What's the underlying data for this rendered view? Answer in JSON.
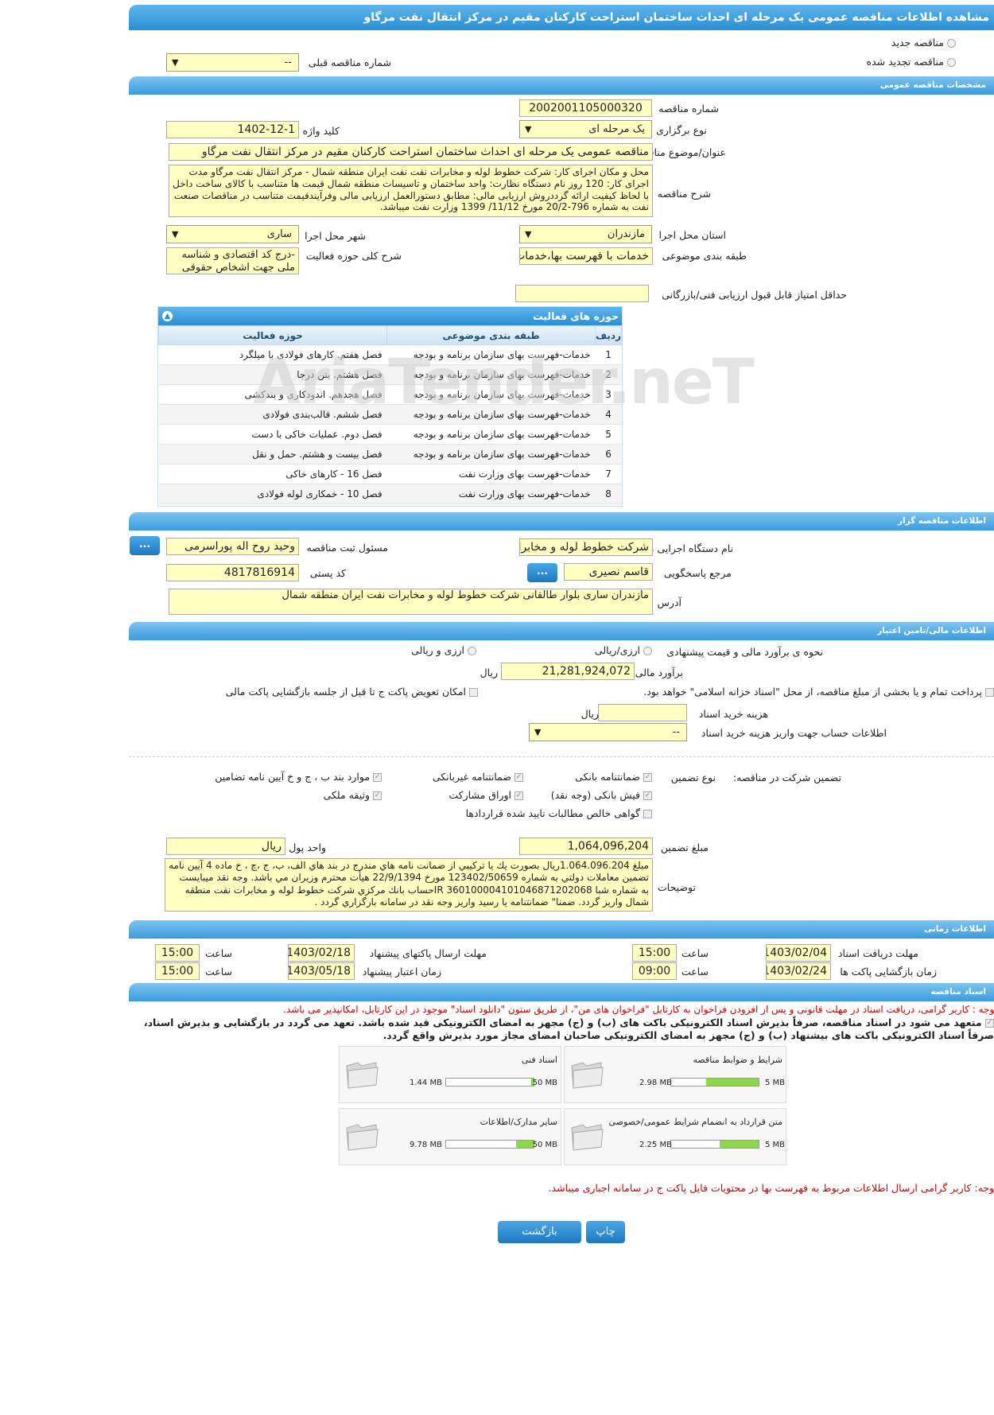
{
  "page_title": "مشاهده اطلاعات مناقصه عمومی یک مرحله ای احداث ساختمان استراحت کارکنان مقیم در مرکز انتقال نفت مرگاو",
  "top": {
    "new_tender": "مناقصه جدید",
    "renewed_tender": "مناقصه تجدید شده",
    "prev_number_label": "شماره مناقصه قبلی",
    "prev_number_value": "--"
  },
  "general": {
    "section": "مشخصات مناقصه عمومی",
    "number_label": "شماره مناقصه",
    "number_value": "2002001105000320",
    "type_label": "نوع برگزاری",
    "type_value": "یک مرحله ای",
    "keyword_label": "کلید واژه",
    "keyword_value": "1402-12-1",
    "subject_label": "عنوان/موضوع مناقصه",
    "subject_value": "مناقصه عمومی یک مرحله ای احداث ساختمان استراحت کارکنان مقیم در مرکز انتقال نفت مرگاو",
    "desc_label": "شرح مناقصه",
    "desc_value": "محل و مکان اجرای کار:  شرکت خطوط لوله و مخابرات نفت  نفت ایران منطقه شمال  - مرکز انتقال نفت مرگاو مدت اجرای کار: 120 روز نام دستگاه نظارت: واحد ساختمان و تاسیسات منطقه شمال قیمت ها متناسب با کالای ساخت داخل با لحاظ کیفیت ارائه گرددروش ارزیابی مالی: مطابق دستورالعمل ارزیابی مالی وفرآیندقیمت متناسب در مناقصات صنعت نفت به شماره 796-20/2 مورخ 11/12/ 1399 وزارت نفت میباشد.",
    "province_label": "استان محل اجرا",
    "province_value": "مازندران",
    "city_label": "شهر محل اجرا",
    "city_value": "ساری",
    "category_label": "طبقه بندی موضوعی",
    "category_value": "خدمات با فهرست بها،خدمات",
    "activity_desc_label": "شرح کلی حوزه فعالیت",
    "activity_desc_value": "-درج کد اقتصادی و شناسه ملی جهت اشخاص حقوقی در",
    "min_score_label": "حداقل امتیاز قابل قبول ارزیابی فنی/بازرگانی",
    "min_score_value": ""
  },
  "activities": {
    "title": "حوزه های فعالیت",
    "headers": [
      "ردیف",
      "طبقه بندی موضوعی",
      "حوزه فعالیت"
    ],
    "rows": [
      [
        "1",
        "خدمات-فهرست بهای سازمان برنامه و بودجه",
        "فصل هفتم. کارهای فولادی با میلگرد"
      ],
      [
        "2",
        "خدمات-فهرست بهای سازمان برنامه و بودجه",
        "فصل هشتم. بتن درجا"
      ],
      [
        "3",
        "خدمات-فهرست بهای سازمان برنامه و بودجه",
        "فصل هجدهم. اندودکاری و بندکشی"
      ],
      [
        "4",
        "خدمات-فهرست بهای سازمان برنامه و بودجه",
        "فصل ششم. قالب‌بندی فولادی"
      ],
      [
        "5",
        "خدمات-فهرست بهای سازمان برنامه و بودجه",
        "فصل دوم. عملیات خاکی با دست"
      ],
      [
        "6",
        "خدمات-فهرست بهای سازمان برنامه و بودجه",
        "فصل بیست و هشتم. حمل و نقل"
      ],
      [
        "7",
        "خدمات-فهرست بهای وزارت نفت",
        "فصل 16 - کارهای خاکی"
      ],
      [
        "8",
        "خدمات-فهرست بهای وزارت نفت",
        "فصل 10 - خمکاری لوله فولادی"
      ]
    ]
  },
  "organizer": {
    "section": "اطلاعات مناقصه گزار",
    "org_label": "نام دستگاه اجرایی مناقصه گزار",
    "org_value": "شرکت خطوط لوله و مخابرات",
    "registrar_label": "مسئول ثبت مناقصه",
    "registrar_value": "وحید روح اله پوراسرمی",
    "contact_label": "مرجع پاسخگویی",
    "contact_value": "قاسم نصیری",
    "postal_label": "کد پستی",
    "postal_value": "4817816914",
    "address_label": "آدرس",
    "address_value": "مازندران ساری بلوار طالقانی شرکت خطوط لوله و مخابرات نفت ایران منطقه شمال",
    "more": "..."
  },
  "finance": {
    "section": "اطلاعات مالی/تامین اعتبار",
    "method_label": "نحوه ی برآورد مالی و قیمت پیشنهادی",
    "opt1": "ارزی/ریالی",
    "opt2": "ارزی و ریالی",
    "estimate_label": "برآورد مالی",
    "estimate_value": "21,281,924,072",
    "currency": "ریال",
    "treasury": "پرداخت تمام و یا بخشی از مبلغ مناقصه، از محل \"اسناد خزانه اسلامی\" خواهد بود.",
    "swap": "امکان تعویض پاکت ج تا قبل از جلسه بازگشایی پاکت مالی",
    "doc_cost_label": "هزینه خرید اسناد",
    "doc_cost_value": "",
    "doc_cost_unit": "ریال",
    "account_label": "اطلاعات حساب جهت واریز هزینه خرید اسناد",
    "account_value": "--"
  },
  "guarantee": {
    "title_label": "تضمین شرکت در مناقصه:",
    "type_label": "نوع تضمین",
    "items": [
      "ضمانتنامه بانکی",
      "ضمانتنامه غیربانکی",
      "موارد بند ب ، ج و خ آیین نامه تضامین",
      "فیش بانکی (وجه نقد)",
      "اوراق مشارکت",
      "وثیقه ملکی",
      "گواهی خالص مطالبات تایید شده قراردادها"
    ],
    "amount_label": "مبلغ تضمین",
    "amount_value": "1,064,096,204",
    "unit_label": "واحد پول",
    "unit_value": "ریال",
    "notes_label": "توضیحات",
    "notes_value": "مبلغ 1.064.096.204ریال  بصورت يك يا تركيبي از ضمانت نامه هاي مندرج در بند هاي الف، ب، ج ،چ ، خ ماده 4 آیین نامه تضمین معاملات دولتي به شماره 123402/50659 مورخ 22/9/1394 هيأت محترم وزيران مي باشد. وجه نقد ميبايست به شماره شبا IR 360100004101046871202068حساب بانك مركزي شركت خطوط لوله و مخابرات نفت منطقه شمال واريز گردد. ضمنا\" ضمانتنامه يا رسيد واريز وجه نقد در سامانه بارگزاري گردد ."
  },
  "timing": {
    "section": "اطلاعات زمانی",
    "doc_receive_label": "مهلت دریافت اسناد",
    "doc_receive_date": "1403/02/04",
    "doc_receive_time": "15:00",
    "submit_label": "مهلت ارسال پاکتهای پیشنهاد",
    "submit_date": "1403/02/18",
    "submit_time": "15:00",
    "open_label": "زمان بازگشایی پاکت ها",
    "open_date": "1403/02/24",
    "open_time": "09:00",
    "valid_label": "زمان اعتبار پیشنهاد",
    "valid_date": "1403/05/18",
    "valid_time": "15:00",
    "time_label": "ساعت"
  },
  "docs": {
    "section": "اسناد مناقصه",
    "note1": "توجه : کاربر گرامی، دریافت اسناد در مهلت قانونی و پس از افزودن فراخوان به کارتابل \"فراخوان های من\"، از طریق ستون \"دانلود اسناد\" موجود در این کارتابل، امکانپذیر می باشد.",
    "commit": "متعهد می شود در اسناد مناقصه، صرفاً بذیرش اسناد الکترونیکی باکت های (ب) و (ج) مجهز به امضای الکترونیکی قید شده باشد. تعهد می گردد در بازگشایی و بذیرش اسناد، صرفاً اسناد الکترونیکی باکت های بیشنهاد (ب) و (ج) مجهز به امضای الکترونیکی صاحبان امضای مجاز مورد بذیرش واقع گردد.",
    "cards": [
      {
        "title": "شرایط و ضوابط مناقصه",
        "used": "2.98 MB",
        "max": "5 MB",
        "fill": 0.6
      },
      {
        "title": "اسناد فنی",
        "used": "1.44 MB",
        "max": "50 MB",
        "fill": 0.03
      },
      {
        "title": "متن قرارداد به انضمام شرایط عمومی/خصوصی",
        "used": "2.25 MB",
        "max": "5 MB",
        "fill": 0.45
      },
      {
        "title": "سایر مدارک/اطلاعات",
        "used": "9.78 MB",
        "max": "50 MB",
        "fill": 0.2
      }
    ],
    "note2": "توجه: کاربر گرامی ارسال اطلاعات مربوط به فهرست بها در محتویات فایل پاکت ج در سامانه اجباری میباشد."
  },
  "buttons": {
    "print": "چاپ",
    "back": "بازگشت"
  },
  "watermark": "AriaTender.neT"
}
